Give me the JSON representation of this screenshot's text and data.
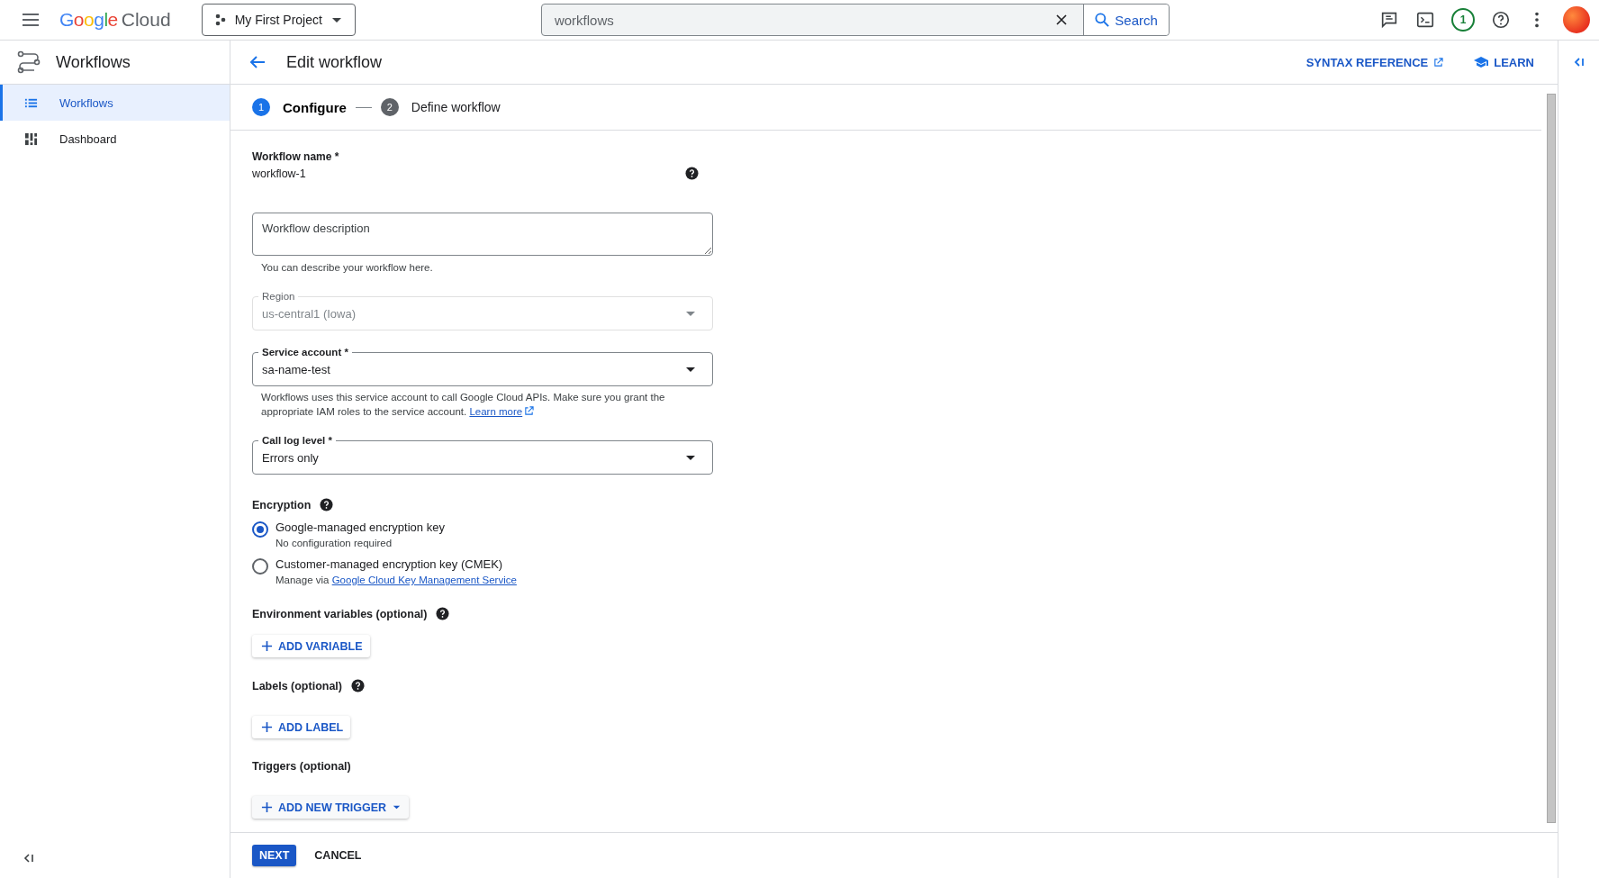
{
  "topbar": {
    "logo_google": "Google",
    "logo_cloud": "Cloud",
    "project": "My First Project",
    "search": {
      "value": "workflows",
      "button": "Search"
    },
    "notification_count": "1"
  },
  "sidebar": {
    "title": "Workflows",
    "items": [
      {
        "label": "Workflows",
        "kind": "list",
        "selected": true
      },
      {
        "label": "Dashboard",
        "kind": "dashboard",
        "selected": false
      }
    ]
  },
  "header": {
    "title": "Edit workflow",
    "links": [
      {
        "label": "SYNTAX REFERENCE",
        "kind": "external"
      },
      {
        "label": "LEARN",
        "kind": "learn"
      }
    ]
  },
  "stepper": [
    {
      "number": "1",
      "label": "Configure",
      "selected": true
    },
    {
      "number": "2",
      "label": "Define workflow",
      "selected": false
    }
  ],
  "form": {
    "name_field": {
      "label": "Workflow name *",
      "value": "workflow-1"
    },
    "description": {
      "placeholder": "Workflow description",
      "hint": "You can describe your workflow here."
    },
    "selects": [
      {
        "label": "Region",
        "value": "us-central1 (Iowa)",
        "disabled": true
      },
      {
        "label": "Service account *",
        "value": "sa-name-test",
        "disabled": false,
        "hint": "Workflows uses this service account to call Google Cloud APIs. Make sure you grant the appropriate IAM roles to the service account.",
        "link": "Learn more"
      },
      {
        "label": "Call log level *",
        "value": "Errors only",
        "disabled": false
      }
    ],
    "encryption": {
      "title": "Encryption",
      "options": [
        {
          "label": "Google-managed encryption key",
          "sub": "No configuration required",
          "selected": true
        },
        {
          "label": "Customer-managed encryption key (CMEK)",
          "sub": "Manage via",
          "link": "Google Cloud Key Management Service",
          "selected": false
        }
      ]
    },
    "sections": [
      {
        "title": "Environment variables (optional)",
        "help": true,
        "button": "ADD VARIABLE",
        "dropdown": false
      },
      {
        "title": "Labels (optional)",
        "help": true,
        "button": "ADD LABEL",
        "dropdown": false
      },
      {
        "title": "Triggers (optional)",
        "help": false,
        "button": "ADD NEW TRIGGER",
        "dropdown": true
      }
    ]
  },
  "footer": {
    "primary": "NEXT",
    "secondary": "CANCEL"
  }
}
